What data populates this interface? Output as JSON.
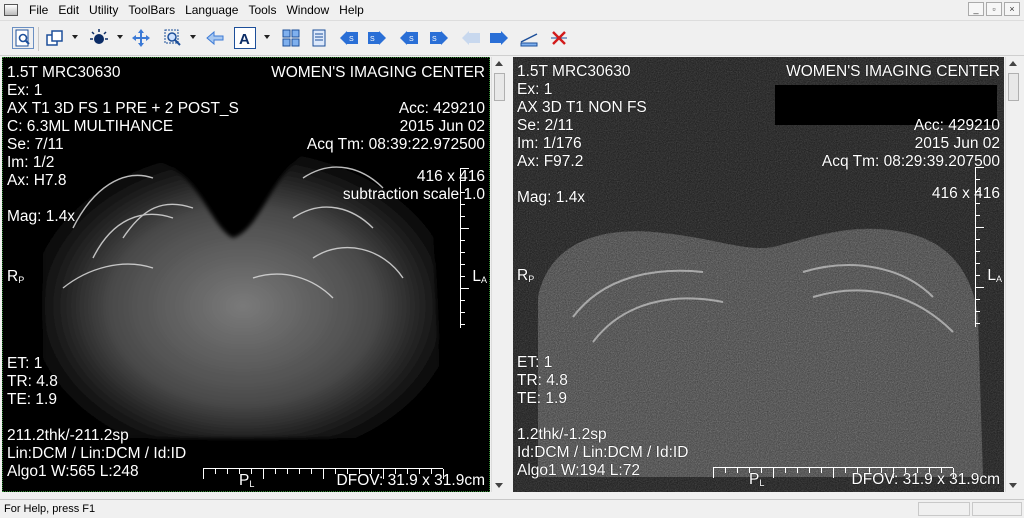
{
  "menu": [
    "File",
    "Edit",
    "Utility",
    "ToolBars",
    "Language",
    "Tools",
    "Window",
    "Help"
  ],
  "window_controls": [
    "_",
    "▫",
    "×"
  ],
  "viewer1": {
    "top_left": [
      "1.5T MRC30630",
      "Ex: 1",
      "AX T1 3D FS 1 PRE + 2 POST_S",
      "C: 6.3ML MULTIHANCE",
      "Se: 7/11",
      "Im: 1/2",
      "Ax: H7.8",
      "",
      "Mag: 1.4x"
    ],
    "top_right": [
      "WOMEN'S IMAGING CENTER",
      "Acc: 429210",
      "2015 Jun 02",
      "Acq Tm: 08:39:22.972500",
      "416 x 416",
      "subtraction scale 1.0"
    ],
    "left_marker": "R",
    "left_marker_sub": "P",
    "right_marker": "L",
    "right_marker_sub": "A",
    "bottom_left": [
      "ET: 1",
      "TR: 4.8",
      "TE: 1.9",
      "",
      "211.2thk/-211.2sp",
      "Lin:DCM / Lin:DCM / Id:ID",
      "Algo1 W:565  L:248"
    ],
    "bottom_marker": "P",
    "bottom_marker_sub": "L",
    "dfov": "DFOV: 31.9 x 31.9cm"
  },
  "viewer2": {
    "top_left": [
      "1.5T MRC30630",
      "Ex: 1",
      "AX  3D T1 NON FS",
      "Se: 2/11",
      "Im: 1/176",
      "Ax: F97.2",
      "",
      "Mag: 1.4x"
    ],
    "top_right": [
      "WOMEN'S IMAGING CENTER",
      "Acc: 429210",
      "2015 Jun 02",
      "Acq Tm: 08:29:39.207500",
      "416 x 416"
    ],
    "left_marker": "R",
    "left_marker_sub": "P",
    "right_marker": "L",
    "right_marker_sub": "A",
    "bottom_left": [
      "ET: 1",
      "TR: 4.8",
      "TE: 1.9",
      "",
      "1.2thk/-1.2sp",
      "Id:DCM / Lin:DCM / Id:ID",
      "Algo1 W:194  L:72"
    ],
    "bottom_marker": "P",
    "bottom_marker_sub": "L",
    "dfov": "DFOV: 31.9 x 31.9cm"
  },
  "status": "For Help, press F1",
  "colors": {
    "toolbar_blue": "#2a6fd6",
    "overlay_text": "#ffffff",
    "active_border": "#2f8a2f"
  }
}
